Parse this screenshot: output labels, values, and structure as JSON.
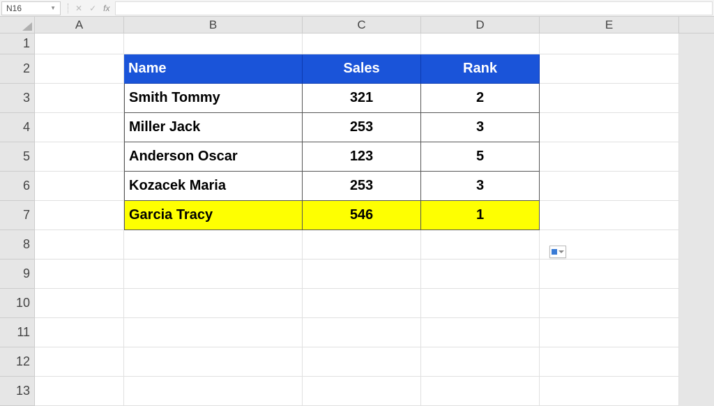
{
  "formula_bar": {
    "name_box": "N16",
    "cancel": "✕",
    "enter": "✓",
    "fx": "fx",
    "formula": ""
  },
  "columns": [
    "A",
    "B",
    "C",
    "D",
    "E"
  ],
  "rows": [
    "1",
    "2",
    "3",
    "4",
    "5",
    "6",
    "7",
    "8",
    "9",
    "10",
    "11",
    "12",
    "13"
  ],
  "table": {
    "headers": {
      "name": "Name",
      "sales": "Sales",
      "rank": "Rank"
    },
    "data": [
      {
        "name": "Smith Tommy",
        "sales": "321",
        "rank": "2",
        "highlight": false
      },
      {
        "name": "Miller Jack",
        "sales": "253",
        "rank": "3",
        "highlight": false
      },
      {
        "name": "Anderson Oscar",
        "sales": "123",
        "rank": "5",
        "highlight": false
      },
      {
        "name": "Kozacek Maria",
        "sales": "253",
        "rank": "3",
        "highlight": false
      },
      {
        "name": "Garcia Tracy",
        "sales": "546",
        "rank": "1",
        "highlight": true
      }
    ]
  },
  "chart_data": {
    "type": "table",
    "columns": [
      "Name",
      "Sales",
      "Rank"
    ],
    "rows": [
      [
        "Smith Tommy",
        321,
        2
      ],
      [
        "Miller Jack",
        253,
        3
      ],
      [
        "Anderson Oscar",
        123,
        5
      ],
      [
        "Kozacek Maria",
        253,
        3
      ],
      [
        "Garcia Tracy",
        546,
        1
      ]
    ],
    "highlighted_row_index": 4,
    "highlight_color": "#feff01",
    "header_color": "#1a54d9"
  }
}
